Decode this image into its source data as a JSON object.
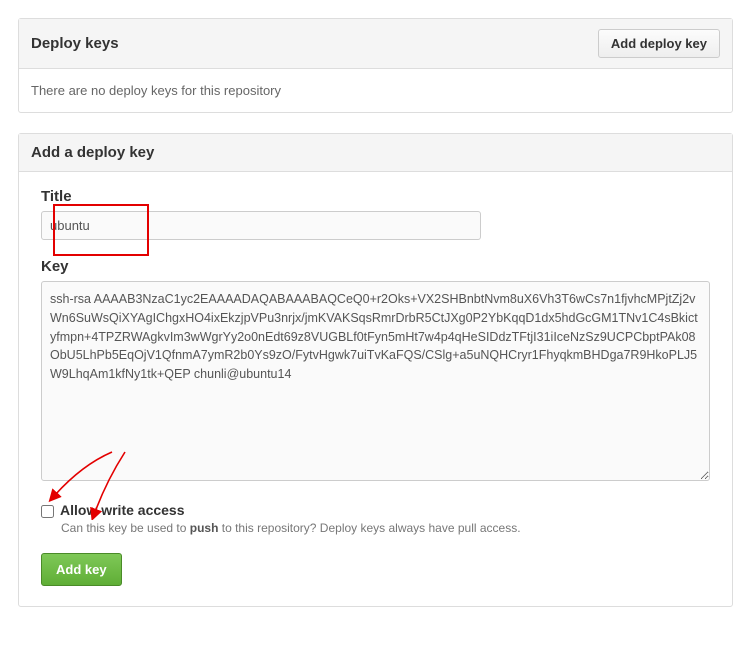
{
  "deploy_keys_panel": {
    "title": "Deploy keys",
    "add_button": "Add deploy key",
    "empty_message": "There are no deploy keys for this repository"
  },
  "add_key_panel": {
    "title": "Add a deploy key",
    "title_field": {
      "label": "Title",
      "value": "ubuntu"
    },
    "key_field": {
      "label": "Key",
      "value": "ssh-rsa AAAAB3NzaC1yc2EAAAADAQABAAABAQCeQ0+r2Oks+VX2SHBnbtNvm8uX6Vh3T6wCs7n1fjvhcMPjtZj2vWn6SuWsQiXYAgIChgxHO4ixEkzjpVPu3nrjx/jmKVAKSqsRmrDrbR5CtJXg0P2YbKqqD1dx5hdGcGM1TNv1C4sBkictyfmpn+4TPZRWAgkvIm3wWgrYy2o0nEdt69z8VUGBLf0tFyn5mHt7w4p4qHeSIDdzTFtjI31iIceNzSz9UCPCbptPAk08ObU5LhPb5EqOjV1QfnmA7ymR2b0Ys9zO/FytvHgwk7uiTvKaFQS/CSlg+a5uNQHCryr1FhyqkmBHDga7R9HkoPLJ5W9LhqAm1kfNy1tk+QEP chunli@ubuntu14"
    },
    "write_access": {
      "label": "Allow write access",
      "help_prefix": "Can this key be used to ",
      "help_bold": "push",
      "help_suffix": " to this repository? Deploy keys always have pull access."
    },
    "submit_button": "Add key"
  }
}
